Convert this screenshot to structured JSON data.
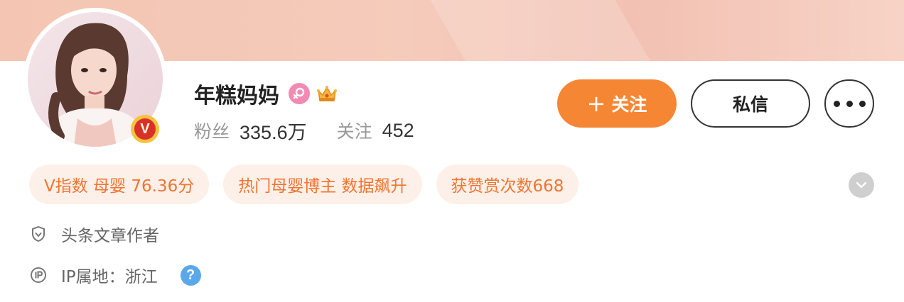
{
  "profile": {
    "name": "年糕妈妈",
    "gender_icon": "female-icon",
    "crown_icon": "crown-icon",
    "verified_badge": "V"
  },
  "stats": {
    "fans_label": "粉丝",
    "fans_value": "335.6万",
    "following_label": "关注",
    "following_value": "452"
  },
  "actions": {
    "follow_plus": "+",
    "follow_label": "关注",
    "message_label": "私信",
    "more_icon": "more-dots-icon"
  },
  "tags": [
    "V指数 母婴 76.36分",
    "热门母婴博主 数据飙升",
    "获赞赏次数668"
  ],
  "info": {
    "author_label": "头条文章作者",
    "ip_label": "IP属地：浙江",
    "help_mark": "?"
  },
  "colors": {
    "accent_orange": "#f58634",
    "tag_background": "#fdf0e9",
    "tag_text": "#f27430",
    "banner": "#f4c5b2",
    "gender_pink": "#f28ab3",
    "help_blue": "#5aa8ea"
  }
}
